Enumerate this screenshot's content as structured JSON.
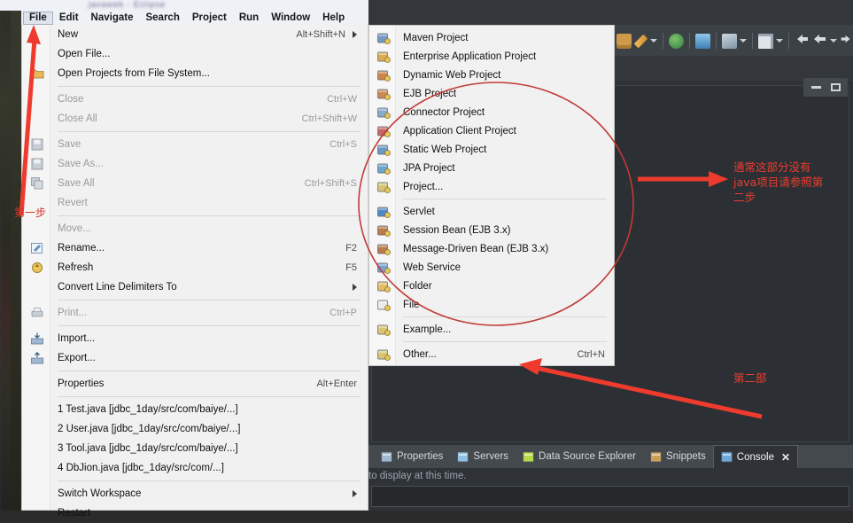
{
  "app": {
    "title": "javaweb - Eclipse",
    "window_controls": {
      "minimize": "minimize-button",
      "maximize": "maximize-button"
    }
  },
  "menubar": {
    "items": [
      {
        "label": "File",
        "active": true
      },
      {
        "label": "Edit",
        "active": false
      },
      {
        "label": "Navigate",
        "active": false
      },
      {
        "label": "Search",
        "active": false
      },
      {
        "label": "Project",
        "active": false
      },
      {
        "label": "Run",
        "active": false
      },
      {
        "label": "Window",
        "active": false
      },
      {
        "label": "Help",
        "active": false
      }
    ]
  },
  "file_menu": {
    "groups": [
      {
        "items": [
          {
            "label": "New",
            "accel": "Alt+Shift+N",
            "submenu": true,
            "disabled": false,
            "icon": "none"
          },
          {
            "label": "Open File...",
            "accel": "",
            "submenu": false,
            "disabled": false,
            "icon": "none"
          },
          {
            "label": "Open Projects from File System...",
            "accel": "",
            "submenu": false,
            "disabled": false,
            "icon": "folder-icon"
          }
        ]
      },
      {
        "items": [
          {
            "label": "Close",
            "accel": "Ctrl+W",
            "submenu": false,
            "disabled": true,
            "icon": "none"
          },
          {
            "label": "Close All",
            "accel": "Ctrl+Shift+W",
            "submenu": false,
            "disabled": true,
            "icon": "none"
          }
        ]
      },
      {
        "items": [
          {
            "label": "Save",
            "accel": "Ctrl+S",
            "submenu": false,
            "disabled": true,
            "icon": "save-icon"
          },
          {
            "label": "Save As...",
            "accel": "",
            "submenu": false,
            "disabled": true,
            "icon": "save-as-icon"
          },
          {
            "label": "Save All",
            "accel": "Ctrl+Shift+S",
            "submenu": false,
            "disabled": true,
            "icon": "save-all-icon"
          },
          {
            "label": "Revert",
            "accel": "",
            "submenu": false,
            "disabled": true,
            "icon": "none"
          }
        ]
      },
      {
        "items": [
          {
            "label": "Move...",
            "accel": "",
            "submenu": false,
            "disabled": true,
            "icon": "none"
          },
          {
            "label": "Rename...",
            "accel": "F2",
            "submenu": false,
            "disabled": false,
            "icon": "rename-icon"
          },
          {
            "label": "Refresh",
            "accel": "F5",
            "submenu": false,
            "disabled": false,
            "icon": "refresh-icon"
          },
          {
            "label": "Convert Line Delimiters To",
            "accel": "",
            "submenu": true,
            "disabled": false,
            "icon": "none"
          }
        ]
      },
      {
        "items": [
          {
            "label": "Print...",
            "accel": "Ctrl+P",
            "submenu": false,
            "disabled": true,
            "icon": "print-icon"
          }
        ]
      },
      {
        "items": [
          {
            "label": "Import...",
            "accel": "",
            "submenu": false,
            "disabled": false,
            "icon": "import-icon"
          },
          {
            "label": "Export...",
            "accel": "",
            "submenu": false,
            "disabled": false,
            "icon": "export-icon"
          }
        ]
      },
      {
        "items": [
          {
            "label": "Properties",
            "accel": "Alt+Enter",
            "submenu": false,
            "disabled": false,
            "icon": "none"
          }
        ]
      },
      {
        "items": [
          {
            "label": "1 Test.java  [jdbc_1day/src/com/baiye/...]",
            "accel": "",
            "submenu": false,
            "disabled": false,
            "icon": "none"
          },
          {
            "label": "2 User.java  [jdbc_1day/src/com/baiye/...]",
            "accel": "",
            "submenu": false,
            "disabled": false,
            "icon": "none"
          },
          {
            "label": "3 Tool.java  [jdbc_1day/src/com/baiye/...]",
            "accel": "",
            "submenu": false,
            "disabled": false,
            "icon": "none"
          },
          {
            "label": "4 DbJion.java  [jdbc_1day/src/com/...]",
            "accel": "",
            "submenu": false,
            "disabled": false,
            "icon": "none"
          }
        ]
      },
      {
        "items": [
          {
            "label": "Switch Workspace",
            "accel": "",
            "submenu": true,
            "disabled": false,
            "icon": "none"
          },
          {
            "label": "Restart",
            "accel": "",
            "submenu": false,
            "disabled": false,
            "icon": "none"
          }
        ]
      }
    ]
  },
  "new_submenu": {
    "groups": [
      {
        "items": [
          {
            "label": "Maven Project",
            "accel": "",
            "icon": "maven-project-icon",
            "color": "#6a8fbf"
          },
          {
            "label": "Enterprise Application Project",
            "accel": "",
            "icon": "enterprise-app-project-icon",
            "color": "#d8a64a"
          },
          {
            "label": "Dynamic Web Project",
            "accel": "",
            "icon": "dynamic-web-project-icon",
            "color": "#c8793c"
          },
          {
            "label": "EJB Project",
            "accel": "",
            "icon": "ejb-project-icon",
            "color": "#c97f45"
          },
          {
            "label": "Connector Project",
            "accel": "",
            "icon": "connector-project-icon",
            "color": "#7fa3c6"
          },
          {
            "label": "Application Client Project",
            "accel": "",
            "icon": "application-client-project-icon",
            "color": "#c05a5a"
          },
          {
            "label": "Static Web Project",
            "accel": "",
            "icon": "static-web-project-icon",
            "color": "#5d8fc0"
          },
          {
            "label": "JPA Project",
            "accel": "",
            "icon": "jpa-project-icon",
            "color": "#5f9ec6"
          },
          {
            "label": "Project...",
            "accel": "",
            "icon": "project-icon",
            "color": "#d6c06a"
          }
        ]
      },
      {
        "items": [
          {
            "label": "Servlet",
            "accel": "",
            "icon": "servlet-icon",
            "color": "#3f7fc1"
          },
          {
            "label": "Session Bean (EJB 3.x)",
            "accel": "",
            "icon": "session-bean-icon",
            "color": "#b4703e"
          },
          {
            "label": "Message-Driven Bean (EJB 3.x)",
            "accel": "",
            "icon": "message-driven-bean-icon",
            "color": "#b4703e"
          },
          {
            "label": "Web Service",
            "accel": "",
            "icon": "web-service-icon",
            "color": "#6a9ad2"
          },
          {
            "label": "Folder",
            "accel": "",
            "icon": "folder-icon",
            "color": "#e0b85a"
          },
          {
            "label": "File",
            "accel": "",
            "icon": "file-icon",
            "color": "#e8e8e8"
          }
        ]
      },
      {
        "items": [
          {
            "label": "Example...",
            "accel": "",
            "icon": "example-icon",
            "color": "#d6c06a"
          }
        ]
      },
      {
        "items": [
          {
            "label": "Other...",
            "accel": "Ctrl+N",
            "icon": "other-icon",
            "color": "#d6c06a"
          }
        ]
      }
    ]
  },
  "toolbar": {
    "icons": [
      {
        "name": "new-wizard-icon",
        "color": "#cf9b4a"
      },
      {
        "name": "edit-pencil-icon",
        "color": "#e8b04a"
      },
      {
        "name": "dropdown-caret-icon",
        "color": "#c9ced2"
      },
      {
        "name": "debug-icon",
        "color": "#4fa05a"
      },
      {
        "name": "run-icon",
        "color": "#4f7fb5"
      },
      {
        "name": "external-tools-icon",
        "color": "#9ab4cc"
      },
      {
        "name": "dropdown-caret-icon-2",
        "color": "#c9ced2"
      },
      {
        "name": "open-type-icon",
        "color": "#d8dce0"
      },
      {
        "name": "dropdown-caret-icon-3",
        "color": "#c9ced2"
      },
      {
        "name": "back-icon",
        "color": "#d8dce0"
      },
      {
        "name": "back-arrow-icon",
        "color": "#d8dce0"
      },
      {
        "name": "dropdown-caret-icon-4",
        "color": "#c9ced2"
      },
      {
        "name": "forward-icon",
        "color": "#d8dce0"
      }
    ]
  },
  "bottom_panel": {
    "tabs": [
      {
        "label": "Properties",
        "icon": "properties-icon",
        "color": "#9fb7cf",
        "active": false,
        "closable": false
      },
      {
        "label": "Servers",
        "icon": "servers-icon",
        "color": "#8fc0e0",
        "active": false,
        "closable": false
      },
      {
        "label": "Data Source Explorer",
        "icon": "data-source-explorer-icon",
        "color": "#b5d94a",
        "active": false,
        "closable": false
      },
      {
        "label": "Snippets",
        "icon": "snippets-icon",
        "color": "#c9a05a",
        "active": false,
        "closable": false
      },
      {
        "label": "Console",
        "icon": "console-icon",
        "color": "#6fa8d8",
        "active": true,
        "closable": true,
        "close_label": "✕"
      }
    ],
    "console_text": "to display at this time."
  },
  "annotations": {
    "step_one": "第一步",
    "step_two": "第二部",
    "note_right": "通常这部分没有\njava项目请参照第\n二步",
    "accent_color": "#ef3b2d",
    "circle_color": "#c03a36"
  }
}
